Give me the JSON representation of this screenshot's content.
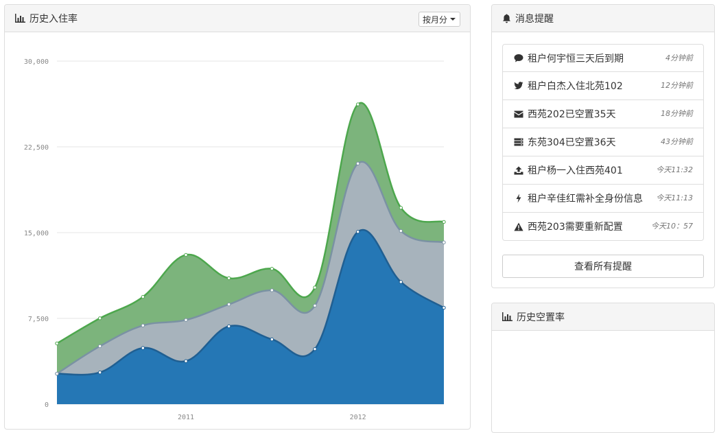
{
  "chart_panel": {
    "title": "历史入住率",
    "period_label": "按月分"
  },
  "alerts_panel": {
    "title": "消息提醒",
    "items": [
      {
        "icon": "comment-icon",
        "text": "租户何宇恒三天后到期",
        "time": "4分钟前"
      },
      {
        "icon": "twitter-icon",
        "text": "租户白杰入住北苑102",
        "time": "12分钟前"
      },
      {
        "icon": "envelope-icon",
        "text": "西苑202已空置35天",
        "time": "18分钟前"
      },
      {
        "icon": "server-icon",
        "text": "东苑304已空置36天",
        "time": "43分钟前"
      },
      {
        "icon": "upload-icon",
        "text": "租户杨一入住西苑401",
        "time": "今天11:32"
      },
      {
        "icon": "bolt-icon",
        "text": "租户辛佳红需补全身份信息",
        "time": "今天11:13"
      },
      {
        "icon": "warning-icon",
        "text": "西苑203需要重新配置",
        "time": "今天10：57"
      }
    ],
    "view_all_label": "查看所有提醒"
  },
  "vacancy_panel": {
    "title": "历史空置率"
  },
  "chart_data": {
    "type": "area",
    "stacked": true,
    "title": "历史入住率",
    "xlabel": "",
    "ylabel": "",
    "ylim": [
      0,
      30000
    ],
    "yticks": [
      "0",
      "7,500",
      "15,000",
      "22,500",
      "30,000"
    ],
    "yticks_values": [
      0,
      7500,
      15000,
      22500,
      30000
    ],
    "x": [
      "2010 Q1",
      "2010 Q2",
      "2010 Q3",
      "2010 Q4",
      "2011 Q1",
      "2011 Q2",
      "2011 Q3",
      "2011 Q4",
      "2012 Q1",
      "2012 Q2"
    ],
    "xticks": [
      {
        "label": "2011",
        "at": "2010 Q4"
      },
      {
        "label": "2012",
        "at": "2011 Q4"
      }
    ],
    "series": [
      {
        "color": "#2577b5",
        "values": [
          2666,
          2778,
          4912,
          3767,
          6810,
          5670,
          4820,
          15073,
          10687,
          8432
        ]
      },
      {
        "color": "#a7b3bc",
        "values": [
          0,
          2294,
          1969,
          3597,
          1914,
          4293,
          3795,
          5967,
          4460,
          5713
        ]
      },
      {
        "color": "#7cb47c",
        "values": [
          2647,
          2441,
          2501,
          5689,
          2293,
          1881,
          1588,
          5175,
          2028,
          1791
        ]
      }
    ],
    "colors": {
      "series_1_line": "#205f92",
      "series_2_line": "#7a92a3",
      "series_3_line": "#4da74d",
      "grid": "#e5e5e5"
    },
    "grid": true,
    "legend": "none"
  }
}
